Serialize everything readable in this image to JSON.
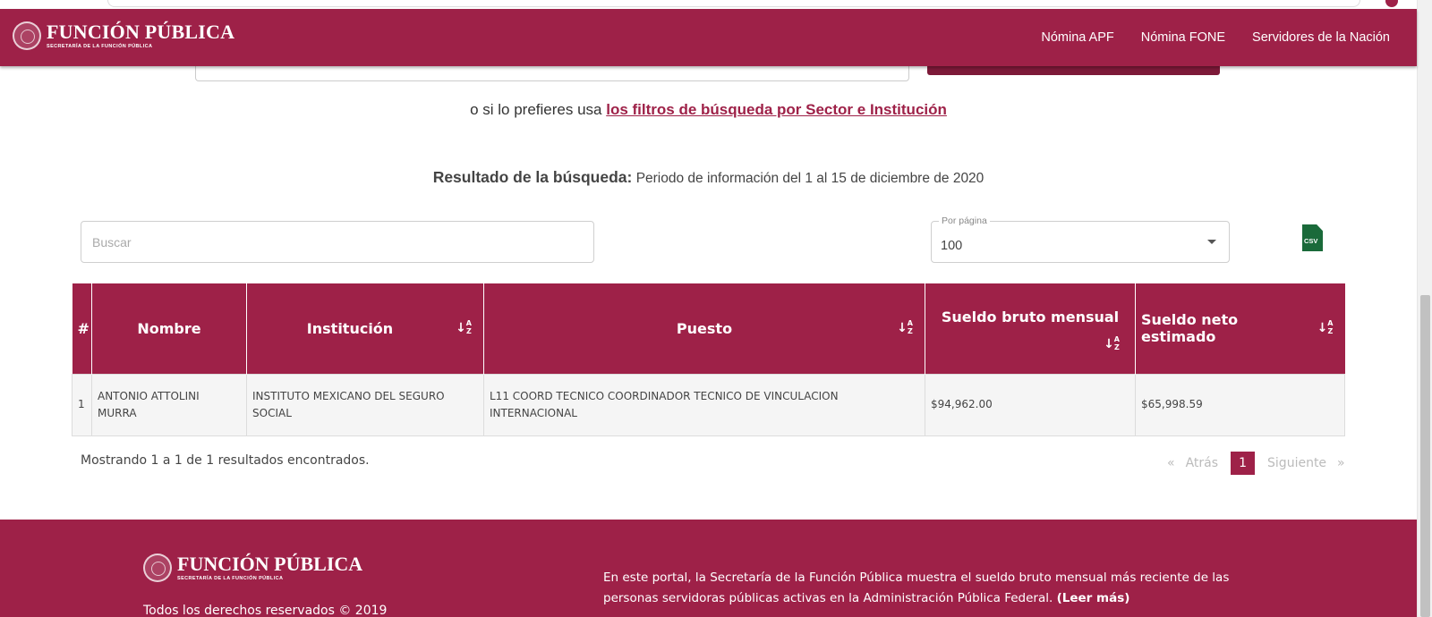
{
  "header": {
    "logo_title": "FUNCIÓN PÚBLICA",
    "logo_subtitle": "SECRETARÍA DE LA FUNCIÓN PÚBLICA",
    "nav": [
      "Nómina APF",
      "Nómina FONE",
      "Servidores de la Nación"
    ]
  },
  "filters_line": {
    "prefix": "o si lo prefieres usa ",
    "link": "los filtros de búsqueda por Sector e Institución"
  },
  "result": {
    "label": "Resultado de la búsqueda:",
    "period": "Periodo de información del 1 al 15 de diciembre de 2020"
  },
  "controls": {
    "search_placeholder": "Buscar",
    "per_page_label": "Por página",
    "per_page_value": "100",
    "csv_label": "CSV"
  },
  "table": {
    "headers": [
      "#",
      "Nombre",
      "Institución",
      "Puesto",
      "Sueldo bruto mensual",
      "Sueldo neto estimado"
    ],
    "sort_glyph": "↓",
    "sort_a": "A",
    "sort_z": "Z",
    "rows": [
      {
        "num": "1",
        "nombre": "ANTONIO ATTOLINI MURRA",
        "institucion": "INSTITUTO MEXICANO DEL SEGURO SOCIAL",
        "puesto": "L11 COORD TECNICO COORDINADOR TECNICO DE VINCULACION INTERNACIONAL",
        "bruto": "$94,962.00",
        "neto": "$65,998.59"
      }
    ]
  },
  "showing": "Mostrando 1 a 1 de 1 resultados encontrados.",
  "pagination": {
    "first": "«",
    "prev": "Atrás",
    "current": "1",
    "next": "Siguiente",
    "last": "»"
  },
  "footer": {
    "logo_title": "FUNCIÓN PÚBLICA",
    "logo_subtitle": "SECRETARÍA DE LA FUNCIÓN PÚBLICA",
    "rights": "Todos los derechos reservados © 2019",
    "description": "En este portal, la Secretaría de la Función Pública muestra el sueldo bruto mensual más reciente de las personas servidoras públicas activas en la Administración Pública Federal.",
    "read_more": "(Leer más)"
  },
  "colors": {
    "brand": "#9e2148",
    "csv_green": "#1a6a3a"
  }
}
